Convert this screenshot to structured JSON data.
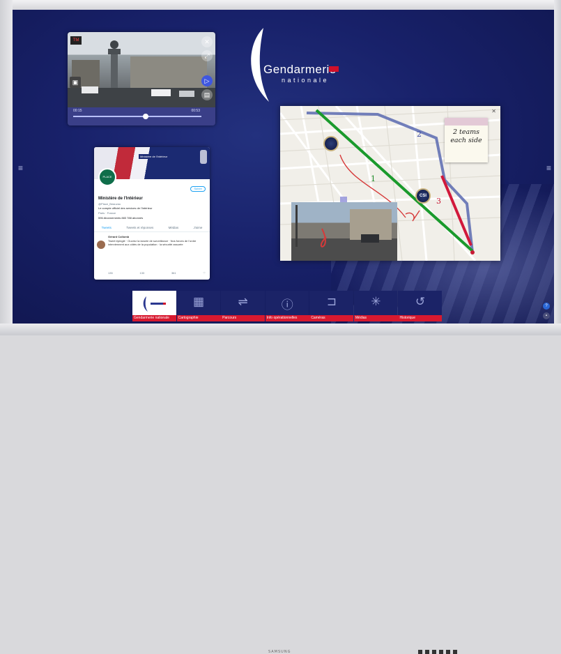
{
  "logo": {
    "word": "Gendarmerie",
    "sub": "nationale"
  },
  "video": {
    "time_left": "00:15",
    "time_right": "00:53",
    "channel_badge": "TM"
  },
  "twitter": {
    "banner_caption": "Ministère de l'Intérieur",
    "avatar_text": "PLACE BEAUVAU",
    "follow": "Suivre",
    "name": "Ministère de l'Intérieur",
    "handle": "@Place_Beauvau",
    "bio": "Le compte officiel des services de l'Intérieur",
    "meta": "Paris · France",
    "stats": "596 Abonnements   883 788 abonnés",
    "tabs": [
      "Tweets",
      "Tweets et réponses",
      "Médias",
      "J'aime"
    ],
    "tweet_author": "Gérard Collomb",
    "tweet_text": "Tweet épinglé · Ouvrez la lancée de surveillance · Nos forces de l'ordre interviennent aux côtés de la population · la sécurité assurée",
    "tweet_actions": [
      "135",
      "133",
      "361",
      "♡"
    ]
  },
  "map": {
    "route_labels": [
      "1",
      "2",
      "3"
    ],
    "sticky_text": "2 teams each side",
    "badges": [
      "CSI",
      ""
    ]
  },
  "appbar": {
    "items": [
      {
        "label": "Gendarmerie nationale",
        "icon": "logo-thumb"
      },
      {
        "label": "Cartographie",
        "icon": "▦"
      },
      {
        "label": "Parcours",
        "icon": "⇌"
      },
      {
        "label": "Info opérationnelles",
        "icon": "ⓘ"
      },
      {
        "label": "Caméras",
        "icon": "⊐"
      },
      {
        "label": "Médias",
        "icon": "✳"
      },
      {
        "label": "Historique",
        "icon": "↺"
      }
    ]
  },
  "bezel": {
    "brand": "SAMSUNG"
  }
}
